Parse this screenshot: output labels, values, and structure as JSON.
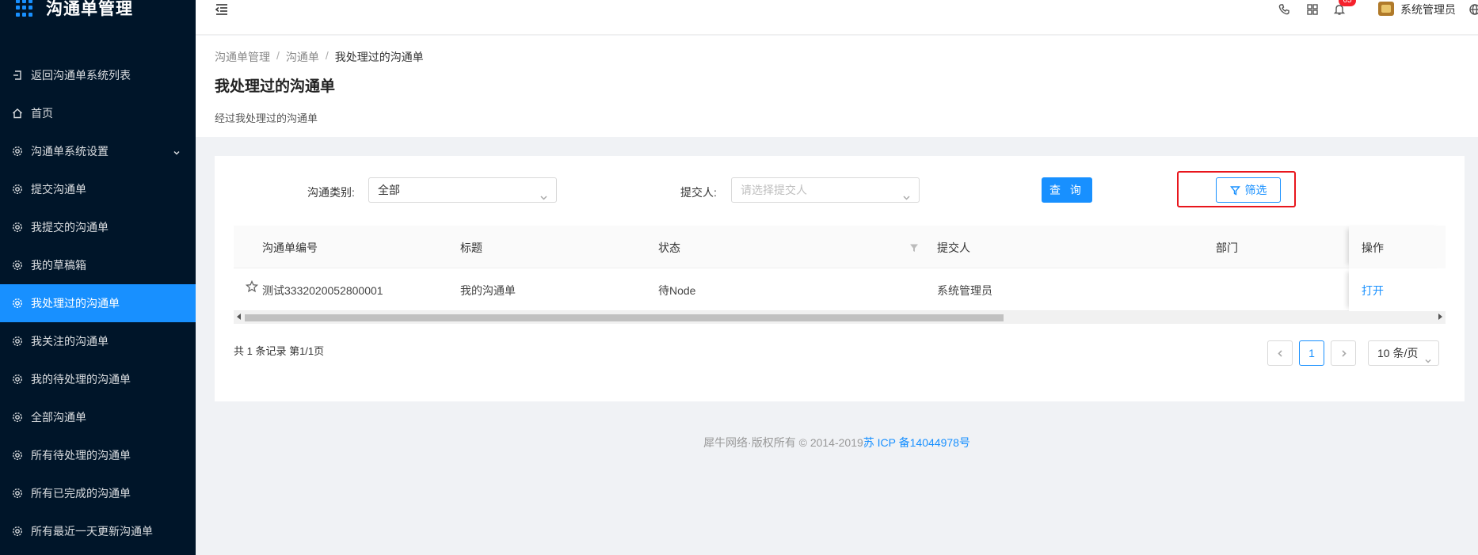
{
  "app": {
    "title": "沟通单管理"
  },
  "sidebar": {
    "items": [
      {
        "label": "返回沟通单系统列表",
        "icon": "return-icon"
      },
      {
        "label": "首页",
        "icon": "home-icon"
      },
      {
        "label": "沟通单系统设置",
        "icon": "gear-icon",
        "has_submenu": true
      },
      {
        "label": "提交沟通单",
        "icon": "gear-icon"
      },
      {
        "label": "我提交的沟通单",
        "icon": "gear-icon"
      },
      {
        "label": "我的草稿箱",
        "icon": "gear-icon"
      },
      {
        "label": "我处理过的沟通单",
        "icon": "gear-icon",
        "active": true
      },
      {
        "label": "我关注的沟通单",
        "icon": "gear-icon"
      },
      {
        "label": "我的待处理的沟通单",
        "icon": "gear-icon"
      },
      {
        "label": "全部沟通单",
        "icon": "gear-icon"
      },
      {
        "label": "所有待处理的沟通单",
        "icon": "gear-icon"
      },
      {
        "label": "所有已完成的沟通单",
        "icon": "gear-icon"
      },
      {
        "label": "所有最近一天更新沟通单",
        "icon": "gear-icon"
      }
    ]
  },
  "header": {
    "notification_count": "65",
    "user_name": "系统管理员",
    "icons": [
      "fold-icon",
      "phone-icon",
      "grid-icon",
      "bell-icon",
      "globe-icon"
    ]
  },
  "page": {
    "breadcrumb": [
      "沟通单管理",
      "沟通单",
      "我处理过的沟通单"
    ],
    "title": "我处理过的沟通单",
    "description": "经过我处理过的沟通单"
  },
  "filters": {
    "category_label": "沟通类别:",
    "category_value": "全部",
    "submitter_label": "提交人:",
    "submitter_placeholder": "请选择提交人",
    "query_button": "查 询",
    "filter_button": "筛选"
  },
  "table": {
    "columns": [
      "沟通单编号",
      "标题",
      "状态",
      "提交人",
      "部门",
      "操作"
    ],
    "rows": [
      {
        "id": "测试3332020052800001",
        "title": "我的沟通单",
        "status": "待Node",
        "submitter": "系统管理员",
        "department": "",
        "action": "打开"
      }
    ]
  },
  "pagination": {
    "summary": "共 1 条记录 第1/1页",
    "current_page": "1",
    "page_size": "10 条/页"
  },
  "footer": {
    "copyright": "犀牛网络·版权所有 © 2014-2019",
    "icp": "苏 ICP 备14044978号"
  },
  "colors": {
    "primary": "#1890ff",
    "sidebar_bg": "#001529",
    "highlight": "#e8161c"
  }
}
